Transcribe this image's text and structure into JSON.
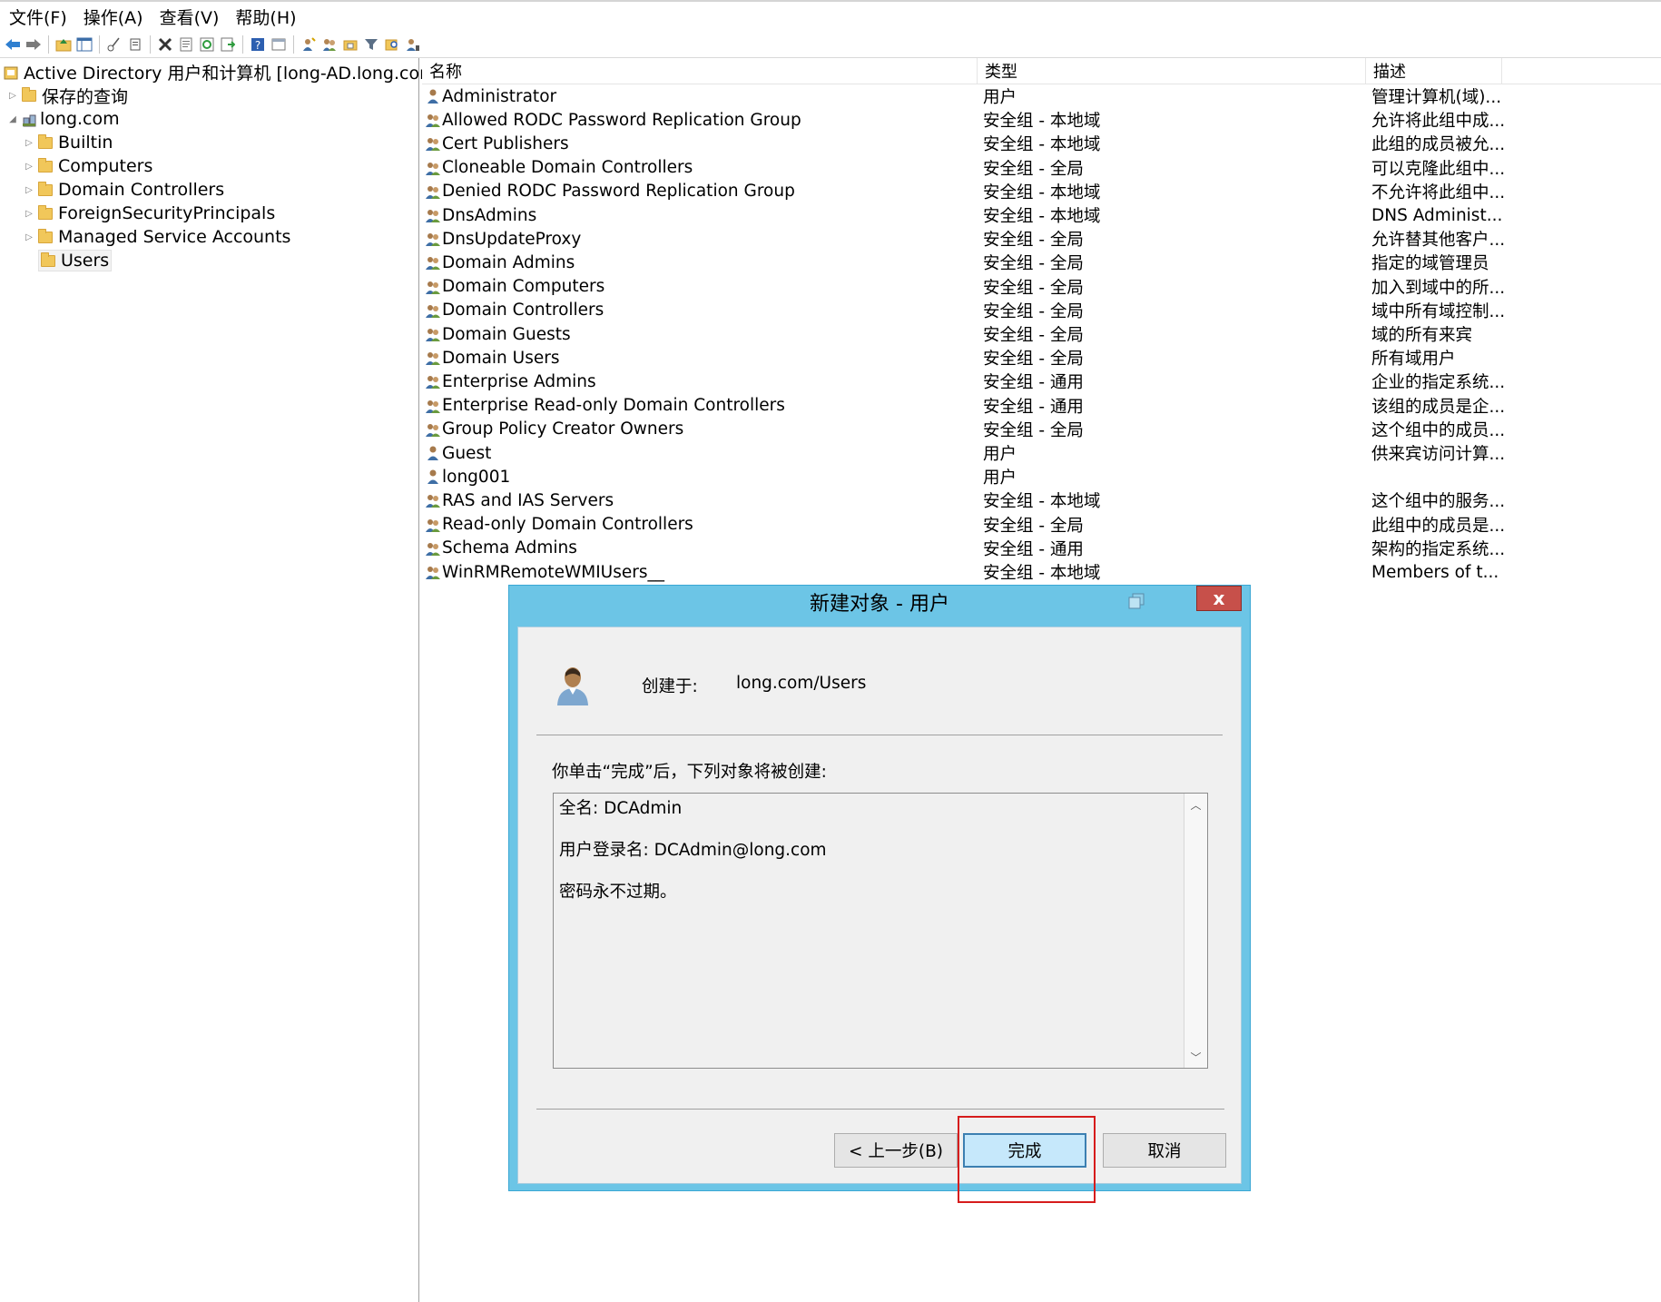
{
  "menu": [
    "文件(F)",
    "操作(A)",
    "查看(V)",
    "帮助(H)"
  ],
  "toolbar_icons": [
    "back-arrow-icon",
    "forward-arrow-icon",
    "up-folder-icon",
    "show-tree-icon",
    "cut-icon",
    "copy-icon",
    "delete-icon",
    "properties-icon",
    "refresh-icon",
    "export-list-icon",
    "help-icon",
    "view-icon",
    "new-user-icon",
    "new-group-icon",
    "new-ou-icon",
    "filter-icon",
    "find-icon",
    "add-to-group-icon"
  ],
  "tree": {
    "root": "Active Directory 用户和计算机 [long-AD.long.com]",
    "saved_queries": "保存的查询",
    "domain": "long.com",
    "children": [
      "Builtin",
      "Computers",
      "Domain Controllers",
      "ForeignSecurityPrincipals",
      "Managed Service Accounts",
      "Users"
    ]
  },
  "list": {
    "columns": [
      "名称",
      "类型",
      "描述"
    ],
    "rows": [
      {
        "name": "Administrator",
        "type": "用户",
        "desc": "管理计算机(域)...",
        "kind": "user"
      },
      {
        "name": "Allowed RODC Password Replication Group",
        "type": "安全组 - 本地域",
        "desc": "允许将此组中成...",
        "kind": "group"
      },
      {
        "name": "Cert Publishers",
        "type": "安全组 - 本地域",
        "desc": "此组的成员被允...",
        "kind": "group"
      },
      {
        "name": "Cloneable Domain Controllers",
        "type": "安全组 - 全局",
        "desc": "可以克隆此组中...",
        "kind": "group"
      },
      {
        "name": "Denied RODC Password Replication Group",
        "type": "安全组 - 本地域",
        "desc": "不允许将此组中...",
        "kind": "group"
      },
      {
        "name": "DnsAdmins",
        "type": "安全组 - 本地域",
        "desc": "DNS Administ...",
        "kind": "group"
      },
      {
        "name": "DnsUpdateProxy",
        "type": "安全组 - 全局",
        "desc": "允许替其他客户...",
        "kind": "group"
      },
      {
        "name": "Domain Admins",
        "type": "安全组 - 全局",
        "desc": "指定的域管理员",
        "kind": "group"
      },
      {
        "name": "Domain Computers",
        "type": "安全组 - 全局",
        "desc": "加入到域中的所...",
        "kind": "group"
      },
      {
        "name": "Domain Controllers",
        "type": "安全组 - 全局",
        "desc": "域中所有域控制...",
        "kind": "group"
      },
      {
        "name": "Domain Guests",
        "type": "安全组 - 全局",
        "desc": "域的所有来宾",
        "kind": "group"
      },
      {
        "name": "Domain Users",
        "type": "安全组 - 全局",
        "desc": "所有域用户",
        "kind": "group"
      },
      {
        "name": "Enterprise Admins",
        "type": "安全组 - 通用",
        "desc": "企业的指定系统...",
        "kind": "group"
      },
      {
        "name": "Enterprise Read-only Domain Controllers",
        "type": "安全组 - 通用",
        "desc": "该组的成员是企...",
        "kind": "group"
      },
      {
        "name": "Group Policy Creator Owners",
        "type": "安全组 - 全局",
        "desc": "这个组中的成员...",
        "kind": "group"
      },
      {
        "name": "Guest",
        "type": "用户",
        "desc": "供来宾访问计算...",
        "kind": "user"
      },
      {
        "name": "long001",
        "type": "用户",
        "desc": "",
        "kind": "user"
      },
      {
        "name": "RAS and IAS Servers",
        "type": "安全组 - 本地域",
        "desc": "这个组中的服务...",
        "kind": "group"
      },
      {
        "name": "Read-only Domain Controllers",
        "type": "安全组 - 全局",
        "desc": "此组中的成员是...",
        "kind": "group"
      },
      {
        "name": "Schema Admins",
        "type": "安全组 - 通用",
        "desc": "架构的指定系统...",
        "kind": "group"
      },
      {
        "name": "WinRMRemoteWMIUsers__",
        "type": "安全组 - 本地域",
        "desc": "Members of t...",
        "kind": "group"
      }
    ]
  },
  "dialog": {
    "title": "新建对象 - 用户",
    "close": "x",
    "created_in_label": "创建于:",
    "created_in_value": "long.com/Users",
    "intro": "你单击“完成”后，下列对象将被创建:",
    "summary": [
      "全名: DCAdmin",
      "用户登录名: DCAdmin@long.com",
      "密码永不过期。"
    ],
    "buttons": {
      "back": "< 上一步(B)",
      "finish": "完成",
      "cancel": "取消"
    }
  },
  "colors": {
    "dialog_frame": "#6cc5e6",
    "close_button": "#c7504a",
    "primary_button": "#c6e8fb",
    "highlight": "#d61c1c"
  }
}
